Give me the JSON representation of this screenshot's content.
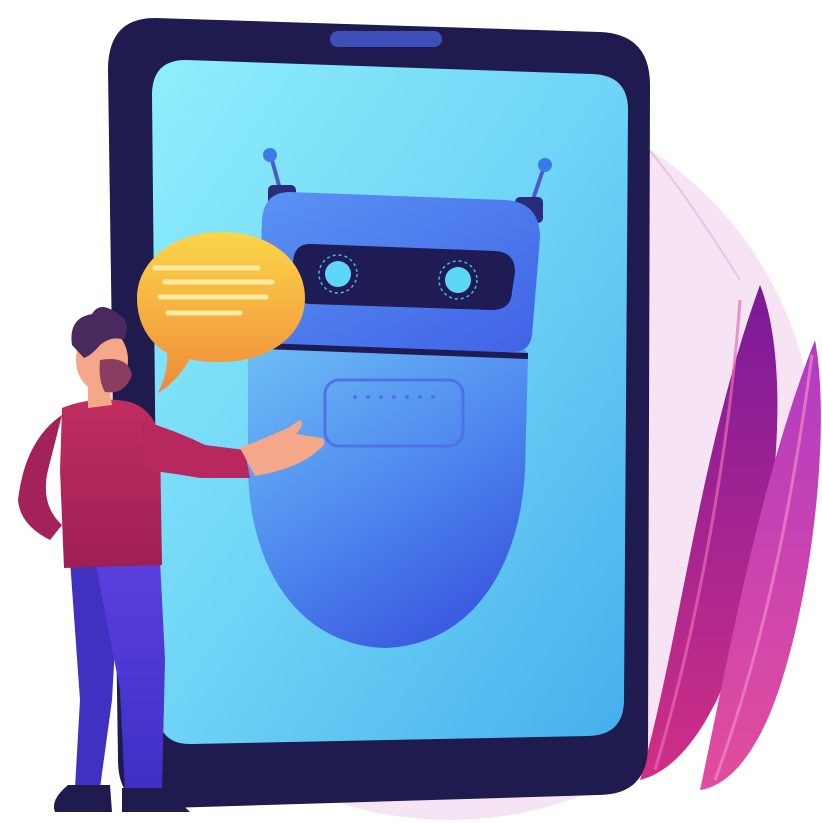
{
  "scene": {
    "subject": "chatbot-illustration",
    "elements": [
      "background-circle",
      "leaves",
      "tablet",
      "robot",
      "speech-bubble",
      "man"
    ]
  },
  "colors": {
    "background_circle": "#F6E4F3",
    "tablet_frame": "#1E1B4B",
    "screen_top": "#8CEBFA",
    "screen_bottom": "#4AB6EE",
    "robot_head": "#4F8AF2",
    "robot_visor": "#1F1C55",
    "robot_eye": "#5ED3F7",
    "speech_bubble_top": "#F9CE47",
    "speech_bubble_bottom": "#F08A3A",
    "shirt": "#B7285E",
    "pants": "#4F3CD9",
    "hair": "#4A2A5E",
    "skin": "#F5A889",
    "leaf_dark": "#8A1A9A",
    "leaf_light": "#C23BB5"
  }
}
